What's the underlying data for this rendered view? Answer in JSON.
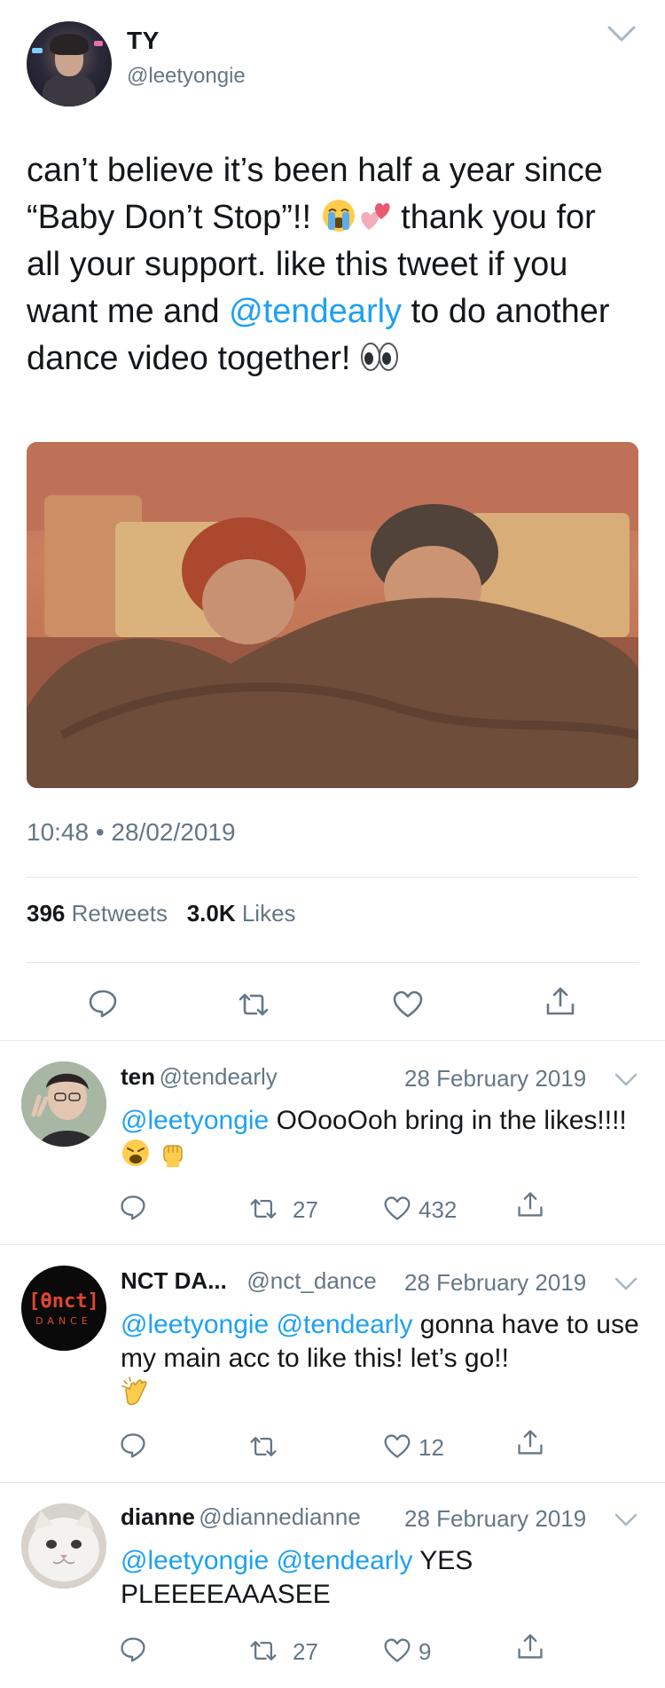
{
  "main_tweet": {
    "display_name": "TY",
    "handle": "@leetyongie",
    "text_1": "can’t believe it’s been half a year since “Baby Don’t Stop”!! ",
    "text_2": " thank you for all your support. like this tweet if you want me and ",
    "mention": "@tendearly",
    "text_3": " to do another dance video together! ",
    "timestamp": "10:48 • 28/02/2019",
    "retweets_count": "396",
    "retweets_label": "Retweets",
    "likes_count": "3.0K",
    "likes_label": "Likes"
  },
  "replies": [
    {
      "name": "ten",
      "handle": "@tendearly",
      "date": "28 February 2019",
      "mention_1": "@leetyongie",
      "text": " OOooOoh bring in the likes!!!! ",
      "retweets": "27",
      "likes": "432"
    },
    {
      "name": "NCT DA...",
      "handle": "@nct_dance",
      "date": "28 February 2019",
      "mention_1": "@leetyongie",
      "mention_2": "@tendearly",
      "text": " gonna have to use my main acc to like this! let’s go!!",
      "avatar_text": "[ϴnct]",
      "avatar_sub": "DANCE",
      "retweets": "",
      "likes": "12"
    },
    {
      "name": "dianne",
      "handle": "@diannedianne",
      "date": "28 February 2019",
      "mention_1": "@leetyongie",
      "mention_2": "@tendearly",
      "text": " YES PLEEEEAAASEE",
      "retweets": "27",
      "likes": "9"
    }
  ],
  "colors": {
    "link": "#1da1f2",
    "secondary": "#657786",
    "text": "#14171a",
    "divider": "#e1e8ed"
  }
}
